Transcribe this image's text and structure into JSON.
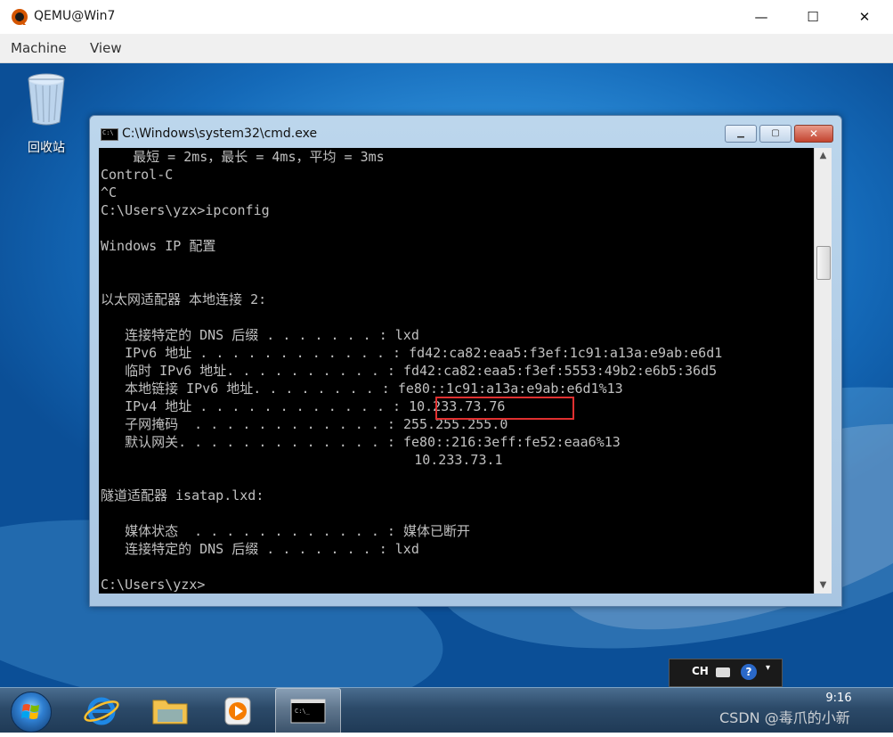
{
  "host": {
    "title": "QEMU@Win7",
    "menu": [
      "Machine",
      "View"
    ],
    "controls": {
      "minimize": "—",
      "maximize": "☐",
      "close": "✕"
    }
  },
  "desktop": {
    "recycle_bin_label": "回收站"
  },
  "cmd": {
    "icon_text": "C:\\",
    "title": "C:\\Windows\\system32\\cmd.exe",
    "lines": [
      "    最短 = 2ms，最长 = 4ms，平均 = 3ms",
      "Control-C",
      "^C",
      "C:\\Users\\yzx>ipconfig",
      "",
      "Windows IP 配置",
      "",
      "",
      "以太网适配器 本地连接 2:",
      "",
      "   连接特定的 DNS 后缀 . . . . . . . : lxd",
      "   IPv6 地址 . . . . . . . . . . . . : fd42:ca82:eaa5:f3ef:1c91:a13a:e9ab:e6d1",
      "   临时 IPv6 地址. . . . . . . . . . : fd42:ca82:eaa5:f3ef:5553:49b2:e6b5:36d5",
      "   本地链接 IPv6 地址. . . . . . . . : fe80::1c91:a13a:e9ab:e6d1%13",
      "   IPv4 地址 . . . . . . . . . . . . : 10.233.73.76",
      "   子网掩码  . . . . . . . . . . . . : 255.255.255.0",
      "   默认网关. . . . . . . . . . . . . : fe80::216:3eff:fe52:eaa6%13",
      "                                       10.233.73.1",
      "",
      "隧道适配器 isatap.lxd:",
      "",
      "   媒体状态  . . . . . . . . . . . . : 媒体已断开",
      "   连接特定的 DNS 后缀 . . . . . . . : lxd",
      "",
      "C:\\Users\\yzx>"
    ]
  },
  "langbar": {
    "lang": "CH",
    "help": "?"
  },
  "taskbar": {
    "clock_time": "9:16",
    "watermark": "CSDN @毒爪的小新"
  }
}
